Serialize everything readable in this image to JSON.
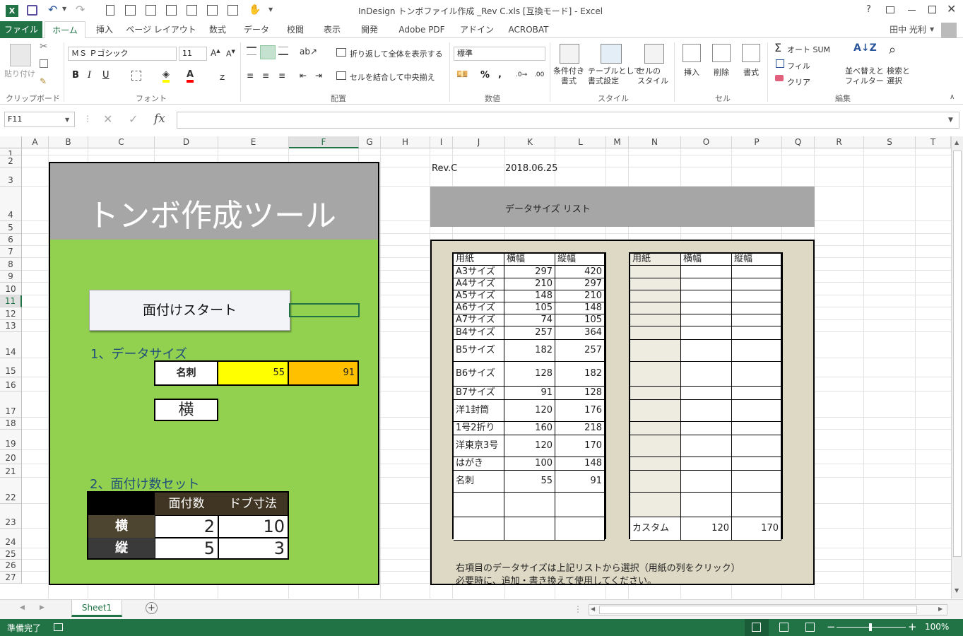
{
  "window": {
    "title": "InDesign トンボファイル作成 _Rev C.xls [互換モード] - Excel",
    "user": "田中 光利"
  },
  "tabs": [
    "ファイル",
    "ホーム",
    "挿入",
    "ページ レイアウト",
    "数式",
    "データ",
    "校閲",
    "表示",
    "開発",
    "Adobe PDF",
    "アドイン",
    "ACROBAT"
  ],
  "ribbon": {
    "clipboard": {
      "paste": "貼り付け",
      "label": "クリップボード"
    },
    "font": {
      "name": "ＭＳ Ｐゴシック",
      "size": "11",
      "label": "フォント"
    },
    "alignment": {
      "wrap": "折り返して全体を表示する",
      "merge": "セルを結合して中央揃え",
      "label": "配置"
    },
    "number": {
      "format": "標準",
      "label": "数値"
    },
    "styles": {
      "cond": "条件付き\n書式",
      "table": "テーブルとして\n書式設定",
      "cell": "セルの\nスタイル",
      "label": "スタイル"
    },
    "cells": {
      "insert": "挿入",
      "delete": "削除",
      "format": "書式",
      "label": "セル"
    },
    "editing": {
      "autosum": "オート SUM",
      "fill": "フィル",
      "clear": "クリア",
      "sort": "並べ替えと\nフィルター",
      "find": "検索と\n選択",
      "label": "編集"
    }
  },
  "namebox": "F11",
  "columns": [
    "A",
    "B",
    "C",
    "D",
    "E",
    "F",
    "G",
    "H",
    "I",
    "J",
    "K",
    "L",
    "M",
    "N",
    "O",
    "P",
    "Q",
    "R",
    "S",
    "T"
  ],
  "rows": [
    "1",
    "2",
    "3",
    "4",
    "5",
    "6",
    "7",
    "8",
    "9",
    "10",
    "11",
    "12",
    "13",
    "14",
    "15",
    "16",
    "17",
    "18",
    "19",
    "20",
    "21",
    "22",
    "23",
    "24",
    "25",
    "26",
    "27"
  ],
  "sheet": {
    "tool_title": "トンボ作成ツール",
    "start_button": "面付けスタート",
    "section1": "1、データサイズ",
    "size_name": "名刺",
    "size_w": "55",
    "size_h": "91",
    "orientation": "横",
    "section2": "2、面付け数セット",
    "imp_headers": [
      "面付数",
      "ドブ寸法"
    ],
    "imp_rows": [
      {
        "label": "横",
        "count": "2",
        "bleed": "10"
      },
      {
        "label": "縦",
        "count": "5",
        "bleed": "3"
      }
    ],
    "rev": "Rev.C",
    "date": "2018.06.25",
    "list_title": "データサイズ リスト",
    "list_headers": [
      "用紙",
      "横幅",
      "縦幅"
    ],
    "list_rows": [
      {
        "name": "A3サイズ",
        "w": "297",
        "h": "420"
      },
      {
        "name": "A4サイズ",
        "w": "210",
        "h": "297"
      },
      {
        "name": "A5サイズ",
        "w": "148",
        "h": "210"
      },
      {
        "name": "A6サイズ",
        "w": "105",
        "h": "148"
      },
      {
        "name": "A7サイズ",
        "w": "74",
        "h": "105"
      },
      {
        "name": "B4サイズ",
        "w": "257",
        "h": "364"
      },
      {
        "name": "B5サイズ",
        "w": "182",
        "h": "257"
      },
      {
        "name": "B6サイズ",
        "w": "128",
        "h": "182"
      },
      {
        "name": "B7サイズ",
        "w": "91",
        "h": "128"
      },
      {
        "name": "洋1封筒",
        "w": "120",
        "h": "176"
      },
      {
        "name": "1号2折り",
        "w": "160",
        "h": "218"
      },
      {
        "name": "洋東京3号",
        "w": "120",
        "h": "170"
      },
      {
        "name": "はがき",
        "w": "100",
        "h": "148"
      },
      {
        "name": "名刺",
        "w": "55",
        "h": "91"
      }
    ],
    "custom_headers": [
      "用紙",
      "横幅",
      "縦幅"
    ],
    "custom_row": {
      "name": "カスタム",
      "w": "120",
      "h": "170"
    },
    "note1": "右項目のデータサイズは上記リストから選択（用紙の列をクリック）",
    "note2": "必要時に、追加・書き換えて使用してください。"
  },
  "sheet_tab": "Sheet1",
  "status": {
    "ready": "準備完了",
    "zoom": "100%"
  },
  "colors": {
    "excel_green": "#217346",
    "panel_green": "#92d050",
    "header_gray": "#a6a6a6",
    "yellow": "#ffff00",
    "orange": "#ffc000",
    "list_bg": "#ddd9c4"
  }
}
